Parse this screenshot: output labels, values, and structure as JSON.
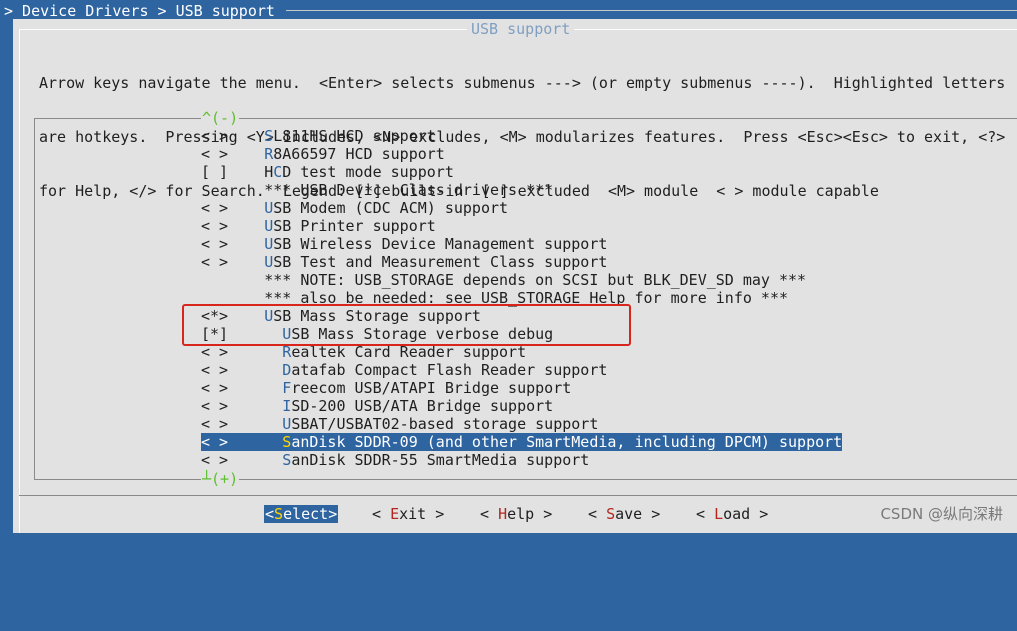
{
  "breadcrumb": "> Device Drivers > USB support",
  "dialog": {
    "title": "USB support",
    "help_lines": [
      "Arrow keys navigate the menu.  <Enter> selects submenus ---> (or empty submenus ----).  Highlighted letters",
      "are hotkeys.  Pressing <Y> includes, <N> excludes, <M> modularizes features.  Press <Esc><Esc> to exit, <?>",
      "for Help, </> for Search.  Legend: [*] built-in  [ ] excluded  <M> module  < > module capable"
    ]
  },
  "menu": {
    "scroll_up": "^(-)",
    "scroll_down": "┴(+)",
    "items": [
      {
        "state": "< >",
        "indent": "",
        "hotkey": "S",
        "rest": "L811HS HCD support"
      },
      {
        "state": "< >",
        "indent": "",
        "hotkey": "R",
        "rest": "8A66597 HCD support"
      },
      {
        "state": "[ ]",
        "indent": "",
        "pre": "H",
        "hotkey": "C",
        "rest": "D test mode support"
      },
      {
        "state": "   ",
        "indent": "",
        "hotkey": "",
        "rest": "*** USB Device Class drivers ***"
      },
      {
        "state": "< >",
        "indent": "",
        "hotkey": "U",
        "rest": "SB Modem (CDC ACM) support"
      },
      {
        "state": "< >",
        "indent": "",
        "hotkey": "U",
        "rest": "SB Printer support"
      },
      {
        "state": "< >",
        "indent": "",
        "hotkey": "U",
        "rest": "SB Wireless Device Management support"
      },
      {
        "state": "< >",
        "indent": "",
        "hotkey": "U",
        "rest": "SB Test and Measurement Class support"
      },
      {
        "state": "   ",
        "indent": "",
        "hotkey": "",
        "rest": "*** NOTE: USB_STORAGE depends on SCSI but BLK_DEV_SD may ***"
      },
      {
        "state": "   ",
        "indent": "",
        "hotkey": "",
        "rest": "*** also be needed: see USB_STORAGE Help for more info ***"
      },
      {
        "state": "<*>",
        "indent": "",
        "hotkey": "U",
        "rest": "SB Mass Storage support"
      },
      {
        "state": "[*]",
        "indent": "  ",
        "hotkey": "U",
        "rest": "SB Mass Storage verbose debug"
      },
      {
        "state": "< >",
        "indent": "  ",
        "hotkey": "R",
        "rest": "ealtek Card Reader support"
      },
      {
        "state": "< >",
        "indent": "  ",
        "hotkey": "D",
        "rest": "atafab Compact Flash Reader support"
      },
      {
        "state": "< >",
        "indent": "  ",
        "hotkey": "F",
        "rest": "reecom USB/ATAPI Bridge support"
      },
      {
        "state": "< >",
        "indent": "  ",
        "hotkey": "I",
        "rest": "SD-200 USB/ATA Bridge support"
      },
      {
        "state": "< >",
        "indent": "  ",
        "hotkey": "U",
        "rest": "SBAT/USBAT02-based storage support"
      },
      {
        "state": "< >",
        "indent": "  ",
        "hotkey": "S",
        "rest": "anDisk SDDR-09 (and other SmartMedia, including DPCM) support",
        "selected": true
      },
      {
        "state": "< >",
        "indent": "  ",
        "hotkey": "S",
        "rest": "anDisk SDDR-55 SmartMedia support"
      }
    ]
  },
  "buttons": {
    "select": {
      "open": "<",
      "hotkey": "S",
      "rest": "elect",
      "close": ">"
    },
    "exit": {
      "open": "< ",
      "hotkey": "E",
      "rest": "xit",
      "close": " >"
    },
    "help": {
      "open": "< ",
      "hotkey": "H",
      "rest": "elp",
      "close": " >"
    },
    "save": {
      "open": "< ",
      "hotkey": "S",
      "rest": "ave",
      "close": " >"
    },
    "load": {
      "open": "< ",
      "hotkey": "L",
      "rest": "oad",
      "close": " >"
    }
  },
  "watermark": "CSDN @纵向深耕",
  "colors": {
    "background": "#2e64a0",
    "dialog": "#e2e2e2",
    "hotkey": "#2e64a0",
    "selected_bg": "#2e64a0",
    "selected_hotkey": "#ffd700",
    "button_hotkey": "#b3261e",
    "scroll_arrow": "#5fbf2f",
    "annotation_box": "#d9261c"
  }
}
